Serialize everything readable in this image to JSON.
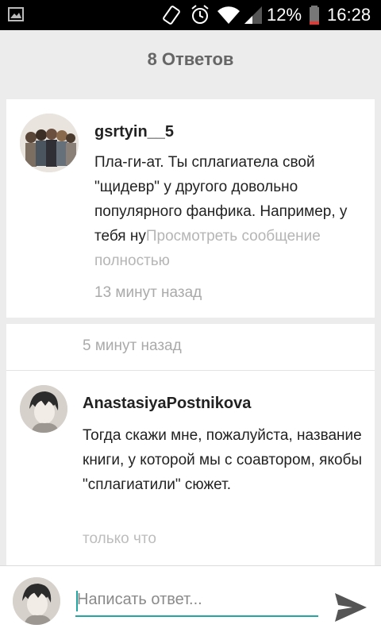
{
  "status_bar": {
    "battery_percent": "12%",
    "time": "16:28",
    "icons": [
      "image-notification-icon",
      "rotate-icon",
      "alarm-icon",
      "wifi-icon",
      "signal-icon",
      "battery-icon"
    ]
  },
  "header": {
    "title": "8 Ответов"
  },
  "comments": [
    {
      "author": "gsrtyin__5",
      "text": "Пла-ги-ат.  Ты сплагиатела свой \"щидевр\" у другого довольно популярного фанфика. Например, у тебя ну",
      "view_more": "Просмотреть сообщение полностью",
      "time": "13 минут назад"
    },
    {
      "time": "5 минут назад"
    },
    {
      "author": "AnastasiyaPostnikova",
      "text": "Тогда скажи мне, пожалуйста, название книги, у которой мы с соавтором, якобы \"сплагиатили\" сюжет.",
      "time": "только что"
    }
  ],
  "composer": {
    "placeholder": "Написать ответ..."
  },
  "colors": {
    "accent": "#25a6a2",
    "background": "#ececec",
    "send_icon": "#555555"
  }
}
